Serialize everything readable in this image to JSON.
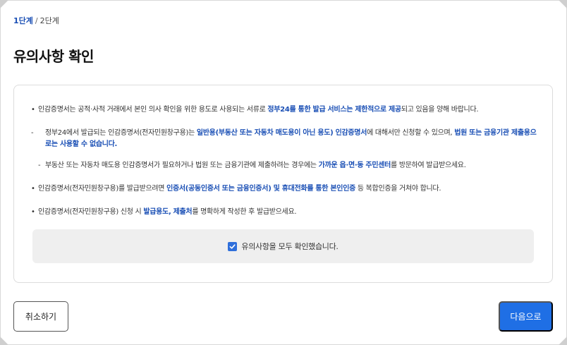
{
  "steps": {
    "current": "1단계",
    "separator": "/",
    "next": "2단계"
  },
  "page_title": "유의사항 확인",
  "notices": {
    "n1": {
      "bullet": "•",
      "text_a": "인감증명서는 공적·사적 거래에서 본인 의사 확인을 위한 용도로 사용되는 서류로 ",
      "em_a": "정부24를 통한 발급 서비스는 제한적으로 제공",
      "text_b": "되고 있음을 양해 바랍니다."
    },
    "n2": {
      "dash": "-",
      "text_a": "정부24에서 발급되는 인감증명서(전자민원창구용)는 ",
      "em_a": "일반용(부동산 또는 자동차 매도용이 아닌 용도) 인감증명서",
      "text_b": "에 대해서만 신청할 수 있으며, ",
      "em_b": "법원 또는 금융기관 제출용으로는 사용할 수 없습니다."
    },
    "n3": {
      "dash": "-",
      "text_a": "부동산 또는 자동차 매도용 인감증명서가 필요하거나 법원 또는 금융기관에 제출하려는 경우에는 ",
      "em_a": "가까운 읍·면·동 주민센터",
      "text_b": "를 방문하여 발급받으세요."
    },
    "n4": {
      "bullet": "•",
      "text_a": "인감증명서(전자민원창구용)를 발급받으려면 ",
      "em_a": "인증서(공동인증서 또는 금융인증서) 및 휴대전화를 통한 본인인증",
      "text_b": " 등 복합인증을 거쳐야 합니다."
    },
    "n5": {
      "bullet": "•",
      "text_a": "인감증명서(전자민원창구용) 신청 시 ",
      "em_a": "발급용도, 제출처",
      "text_b": "를 명확하게 작성한 후 발급받으세요."
    }
  },
  "confirm": {
    "checked": true,
    "label": "유의사항을 모두 확인했습니다."
  },
  "buttons": {
    "cancel": "취소하기",
    "next": "다음으로"
  },
  "colors": {
    "accent": "#1a4fb5",
    "primary_button": "#1f6fe5",
    "checkbox": "#2f6fdb",
    "confirm_background": "#efefef"
  },
  "icons": {
    "checkbox": "check-icon"
  }
}
